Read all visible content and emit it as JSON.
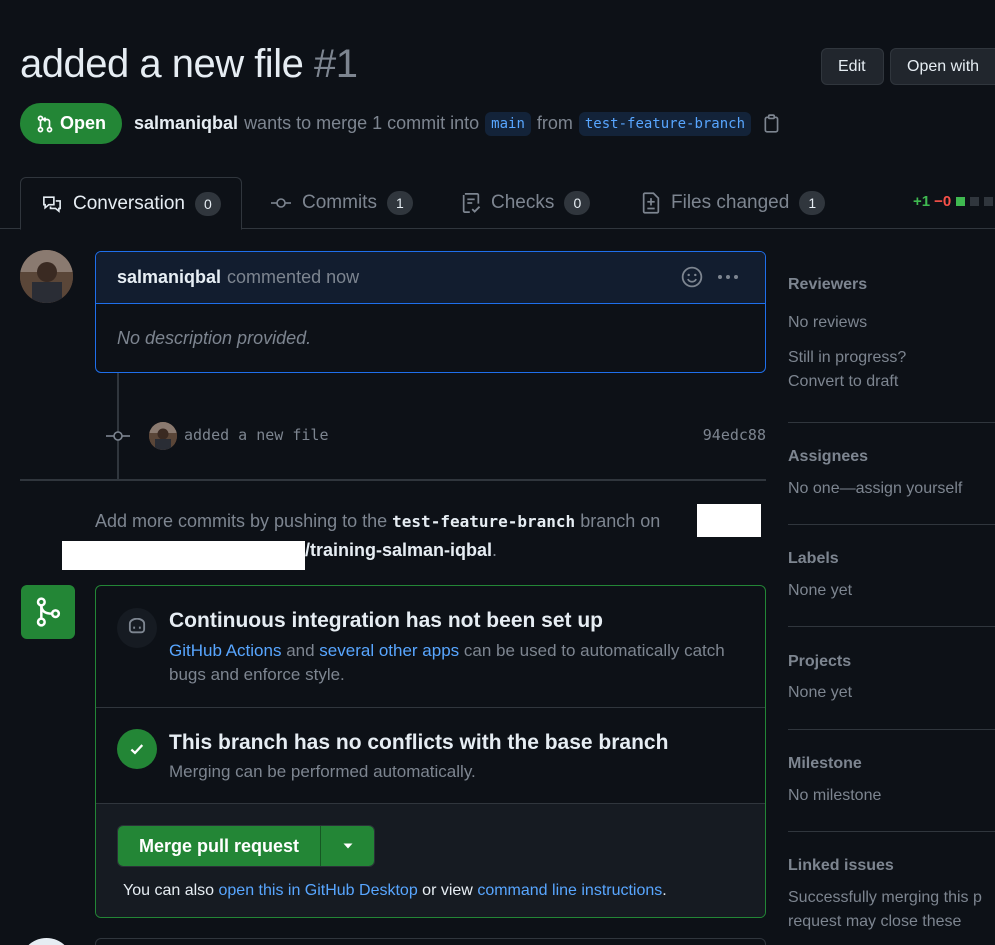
{
  "pr": {
    "title": "added a new file",
    "number": "#1",
    "state": "Open",
    "author": "salmaniqbal",
    "merge_text": "wants to merge 1 commit into",
    "base_branch": "main",
    "from_text": "from",
    "head_branch": "test-feature-branch"
  },
  "header_buttons": {
    "edit": "Edit",
    "open_with": "Open with"
  },
  "tabs": [
    {
      "label": "Conversation",
      "count": "0"
    },
    {
      "label": "Commits",
      "count": "1"
    },
    {
      "label": "Checks",
      "count": "0"
    },
    {
      "label": "Files changed",
      "count": "1"
    }
  ],
  "diffstat": {
    "additions": "+1",
    "deletions": "−0"
  },
  "comment": {
    "author": "salmaniqbal",
    "time_text": "commented now",
    "body": "No description provided."
  },
  "commit": {
    "message": "added a new file",
    "sha": "94edc88"
  },
  "push_info": {
    "prefix": "Add more commits by pushing to the",
    "branch": "test-feature-branch",
    "middle": "branch on",
    "repo": "/training-salman-iqbal",
    "suffix": "."
  },
  "ci": {
    "title": "Continuous integration has not been set up",
    "link1": "GitHub Actions",
    "and": "and",
    "link2": "several other apps",
    "rest": "can be used to automatically catch bugs and enforce style."
  },
  "conflicts": {
    "title": "This branch has no conflicts with the base branch",
    "desc": "Merging can be performed automatically."
  },
  "merge": {
    "button": "Merge pull request",
    "also_prefix": "You can also",
    "desktop_link": "open this in GitHub Desktop",
    "or_view": "or view",
    "cli_link": "command line instructions",
    "suffix": "."
  },
  "sidebar": {
    "reviewers": {
      "title": "Reviewers",
      "value": "No reviews",
      "hint1": "Still in progress?",
      "hint2": "Convert to draft"
    },
    "assignees": {
      "title": "Assignees",
      "value": "No one—assign yourself"
    },
    "labels": {
      "title": "Labels",
      "value": "None yet"
    },
    "projects": {
      "title": "Projects",
      "value": "None yet"
    },
    "milestone": {
      "title": "Milestone",
      "value": "No milestone"
    },
    "linked_issues": {
      "title": "Linked issues",
      "value1": "Successfully merging this p",
      "value2": "request may close these"
    }
  },
  "colors": {
    "bg": "#0d1117",
    "green": "#238636",
    "link": "#58a6ff",
    "muted": "#7d8590",
    "border": "#30363d"
  }
}
